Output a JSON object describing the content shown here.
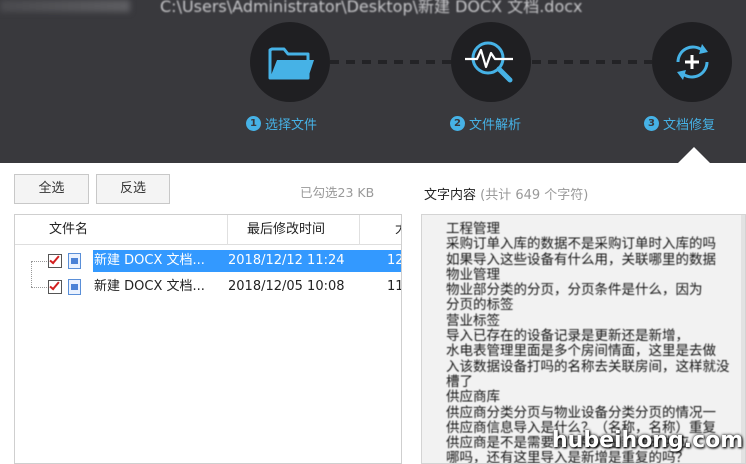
{
  "window": {
    "title": "C:\\Users\\Administrator\\Desktop\\新建 DOCX 文档.docx"
  },
  "steps": [
    {
      "num": "1",
      "label": "选择文件",
      "icon": "folder-icon"
    },
    {
      "num": "2",
      "label": "文件解析",
      "icon": "analyze-icon"
    },
    {
      "num": "3",
      "label": "文档修复",
      "icon": "repair-icon"
    }
  ],
  "colors": {
    "header_bg": "#39393d",
    "accent": "#46b2e6",
    "selection": "#3399ff",
    "checkmark": "#d21f1f"
  },
  "toolbar": {
    "select_all": "全选",
    "invert": "反选",
    "selected_size": "已勾选23 KB"
  },
  "file_list": {
    "columns": [
      "文件名",
      "最后修改时间",
      "大"
    ],
    "rows": [
      {
        "name": "新建 DOCX 文档...",
        "modified": "2018/12/12 11:24",
        "size": "12",
        "checked": true,
        "selected": true
      },
      {
        "name": "新建 DOCX 文档...",
        "modified": "2018/12/05 10:08",
        "size": "11",
        "checked": true,
        "selected": false
      }
    ]
  },
  "content": {
    "heading": "文字内容",
    "count": "(共计 649 个字符)",
    "lines": [
      "工程管理",
      "采购订单入库的数据不是采购订单时入库的吗",
      "如果导入这些设备有什么用，关联哪里的数据",
      "物业管理",
      "物业部分类的分页，分页条件是什么，因为",
      "分页的标签",
      "营业标签",
      "导入已存在的设备记录是更新还是新增，",
      "水电表管理里面是多个房间情面，这里是去做",
      "入该数据设备打吗的名称去关联房间，这样就没",
      "槽了",
      "供应商库",
      "供应商分类分页与物业设备分类分页的情况一",
      "供应商信息导入是什么？（名称，名称）重复",
      "供应商是不是需要填写导入是新增的供应",
      "哪吗，还有这里导入是新增是重复的吗？"
    ]
  },
  "watermark": "hubeihong.com"
}
